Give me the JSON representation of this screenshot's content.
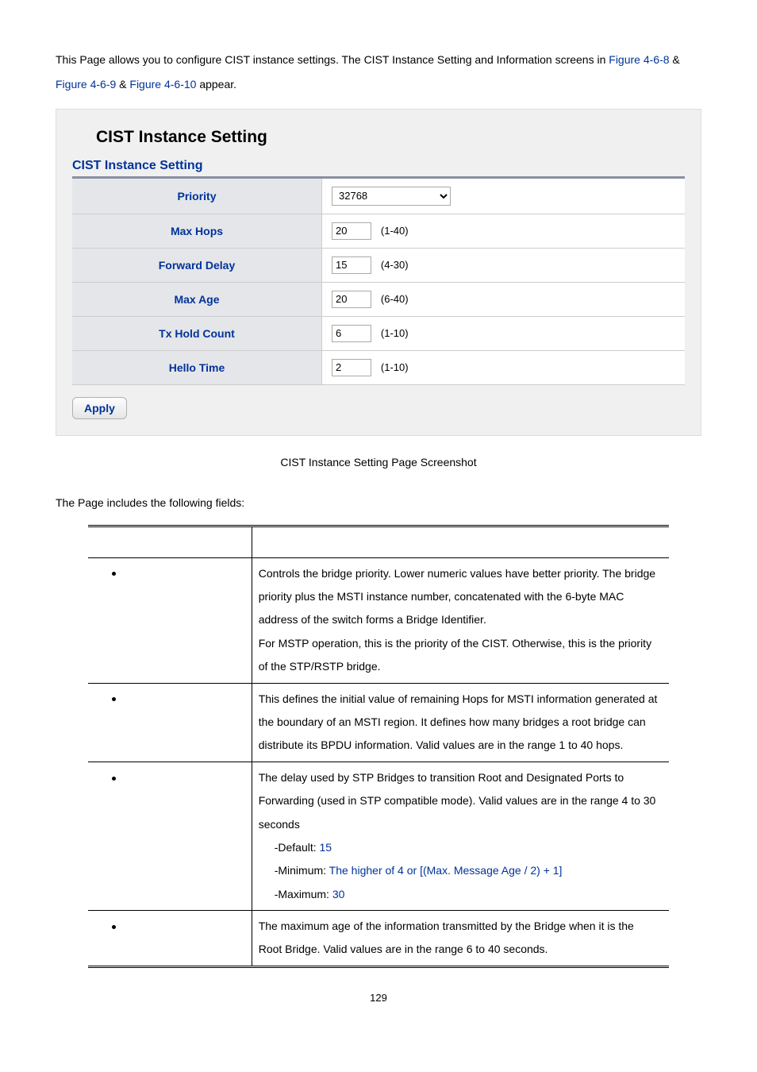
{
  "intro": {
    "part1": "This Page allows you to configure CIST instance settings. The CIST Instance Setting and Information screens in ",
    "link1": "Figure 4-6-8",
    "amp1": " & ",
    "link2": "Figure 4-6-9",
    "amp2": " & ",
    "link3": "Figure 4-6-10",
    "part2": " appear."
  },
  "panel": {
    "title": "CIST Instance  Setting",
    "section": "CIST Instance Setting",
    "rows": {
      "priority_label": "Priority",
      "priority_value": "32768",
      "maxhops_label": "Max Hops",
      "maxhops_value": "20",
      "maxhops_range": "(1-40)",
      "fdelay_label": "Forward Delay",
      "fdelay_value": "15",
      "fdelay_range": "(4-30)",
      "maxage_label": "Max Age",
      "maxage_value": "20",
      "maxage_range": "(6-40)",
      "tx_label": "Tx Hold Count",
      "tx_value": "6",
      "tx_range": "(1-10)",
      "hello_label": "Hello Time",
      "hello_value": "2",
      "hello_range": "(1-10)"
    },
    "apply": "Apply"
  },
  "caption": "CIST Instance Setting Page Screenshot",
  "fields_intro": "The Page includes the following fields:",
  "desc": {
    "priority": {
      "l1": "Controls the bridge priority. Lower numeric values have better priority. The bridge",
      "l2": "priority plus the MSTI instance number, concatenated with the 6-byte MAC",
      "l3": "address of the switch forms a Bridge Identifier.",
      "l4": "For MSTP operation, this is the priority of the CIST. Otherwise, this is the priority",
      "l5": "of the STP/RSTP bridge."
    },
    "maxhops": {
      "l1": "This defines the initial value of remaining Hops for MSTI information generated at",
      "l2": "the boundary of an MSTI region. It defines how many bridges a root bridge can",
      "l3": "distribute its BPDU information. Valid values are in the range 1 to 40 hops."
    },
    "fdelay": {
      "l1": "The delay used by STP Bridges to transition Root and Designated Ports to",
      "l2": "Forwarding (used in STP compatible mode). Valid values are in the range 4 to 30",
      "l3": "seconds",
      "def_lbl": "-Default: ",
      "def_val": "15",
      "min_lbl": "-Minimum: ",
      "min_val": "The higher of 4 or [(Max. Message Age / 2) + 1]",
      "max_lbl": "-Maximum: ",
      "max_val": "30"
    },
    "maxage": {
      "l1": "The maximum age of the information transmitted by the Bridge when it is the",
      "l2": "Root Bridge. Valid values are in the range 6 to 40 seconds."
    }
  },
  "pagenum": "129"
}
